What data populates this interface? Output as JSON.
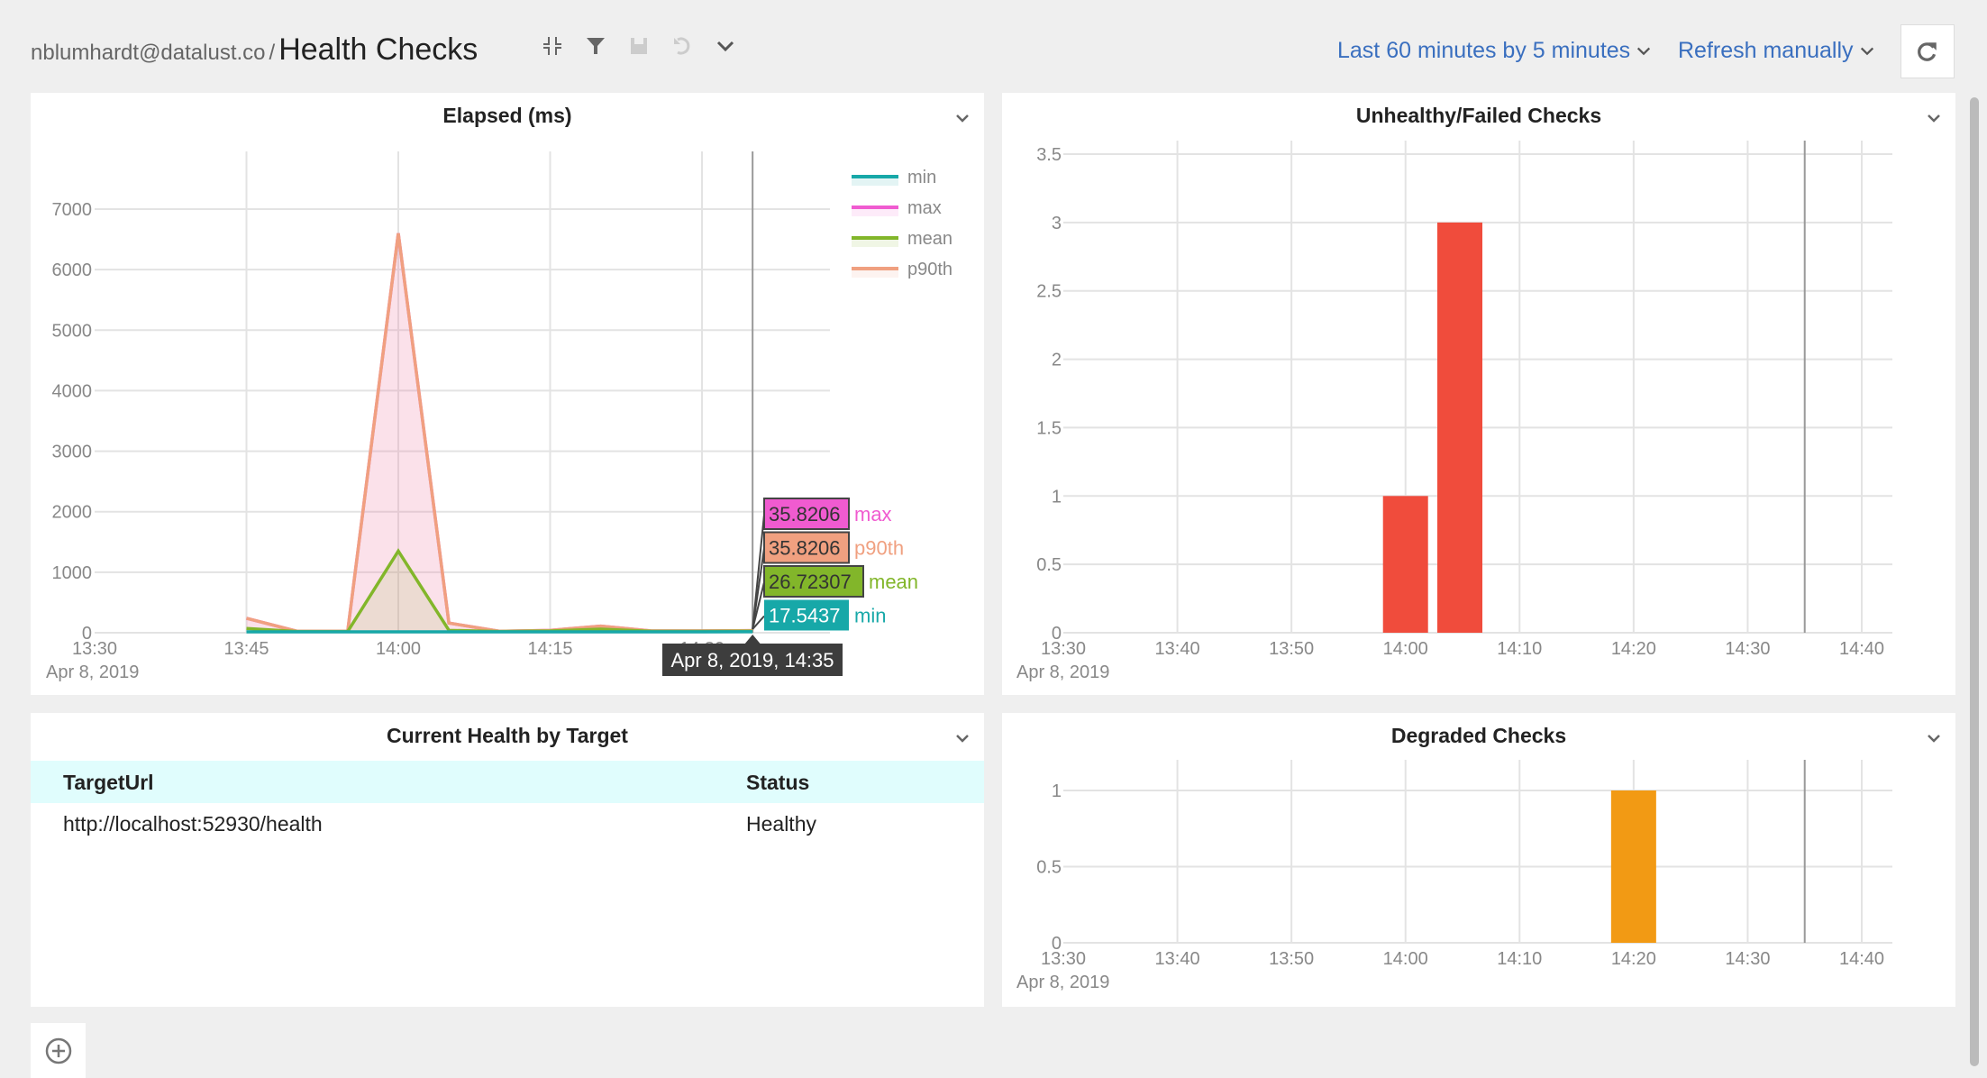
{
  "header": {
    "user": "nblumhardt@datalust.co",
    "separator": "/",
    "title": "Health Checks",
    "toolbar_icons": [
      "collapse-icon",
      "filter-icon",
      "save-icon",
      "undo-icon",
      "chevron-down-icon"
    ],
    "time_range": "Last 60 minutes by 5 minutes",
    "refresh_mode": "Refresh manually",
    "refresh_icon": "refresh-icon"
  },
  "colors": {
    "min": "#17a8a8",
    "max": "#f05bd0",
    "mean": "#82b62a",
    "p90th": "#f0a080",
    "unhealthy": "#f04c3c",
    "degraded": "#f29a14",
    "link": "#3a6fbf",
    "table_header_bg": "#e0fdfd"
  },
  "panels": {
    "elapsed": {
      "title": "Elapsed (ms)"
    },
    "unhealthy": {
      "title": "Unhealthy/Failed Checks"
    },
    "current_health": {
      "title": "Current Health by Target",
      "columns": [
        "TargetUrl",
        "Status"
      ],
      "rows": [
        [
          "http://localhost:52930/health",
          "Healthy"
        ]
      ]
    },
    "degraded": {
      "title": "Degraded Checks"
    }
  },
  "tooltip": {
    "time": "Apr 8, 2019, 14:35",
    "entries": [
      {
        "series": "max",
        "value": "35.8206"
      },
      {
        "series": "p90th",
        "value": "35.8206"
      },
      {
        "series": "mean",
        "value": "26.72307"
      },
      {
        "series": "min",
        "value": "17.5437"
      }
    ]
  },
  "chart_data": [
    {
      "id": "elapsed",
      "type": "area",
      "title": "Elapsed (ms)",
      "xlabel": "",
      "ylabel": "",
      "date_label": "Apr 8, 2019",
      "x": [
        "13:45",
        "13:50",
        "13:55",
        "14:00",
        "14:05",
        "14:10",
        "14:15",
        "14:20",
        "14:25",
        "14:30",
        "14:35"
      ],
      "x_ticks": [
        "13:30",
        "13:45",
        "14:00",
        "14:15",
        "14:30"
      ],
      "x_range": [
        "13:30",
        "14:45"
      ],
      "y_ticks": [
        0,
        1000,
        2000,
        3000,
        4000,
        5000,
        6000,
        7000
      ],
      "ylim": [
        0,
        7800
      ],
      "grid": true,
      "legend": [
        "min",
        "max",
        "mean",
        "p90th"
      ],
      "legend_position": "top-right",
      "cursor": "14:35",
      "series": [
        {
          "name": "min",
          "values": [
            15,
            15,
            15,
            15,
            15,
            15,
            15,
            15,
            15,
            15,
            17.5437
          ]
        },
        {
          "name": "max",
          "values": [
            240,
            25,
            25,
            6600,
            160,
            25,
            40,
            110,
            30,
            30,
            35.8206
          ]
        },
        {
          "name": "mean",
          "values": [
            70,
            20,
            20,
            1350,
            40,
            20,
            30,
            60,
            25,
            25,
            26.72307
          ]
        },
        {
          "name": "p90th",
          "values": [
            240,
            25,
            25,
            6600,
            160,
            25,
            40,
            110,
            30,
            30,
            35.8206
          ]
        }
      ]
    },
    {
      "id": "unhealthy",
      "type": "bar",
      "title": "Unhealthy/Failed Checks",
      "date_label": "Apr 8, 2019",
      "x_ticks": [
        "13:30",
        "13:40",
        "13:50",
        "14:00",
        "14:10",
        "14:20",
        "14:30",
        "14:40"
      ],
      "y_ticks": [
        "0",
        "0.5",
        "1",
        "1.5",
        "2",
        "2.5",
        "3",
        "3.5"
      ],
      "ylim": [
        0,
        3.5
      ],
      "grid": true,
      "cursor": "14:35",
      "categories": [
        "14:00",
        "14:05"
      ],
      "values": [
        1,
        3
      ]
    },
    {
      "id": "degraded",
      "type": "bar",
      "title": "Degraded Checks",
      "date_label": "Apr 8, 2019",
      "x_ticks": [
        "13:30",
        "13:40",
        "13:50",
        "14:00",
        "14:10",
        "14:20",
        "14:30",
        "14:40"
      ],
      "y_ticks": [
        "0",
        "0.5",
        "1"
      ],
      "ylim": [
        0,
        1
      ],
      "grid": true,
      "cursor": "14:35",
      "categories": [
        "14:20"
      ],
      "values": [
        1
      ]
    }
  ]
}
